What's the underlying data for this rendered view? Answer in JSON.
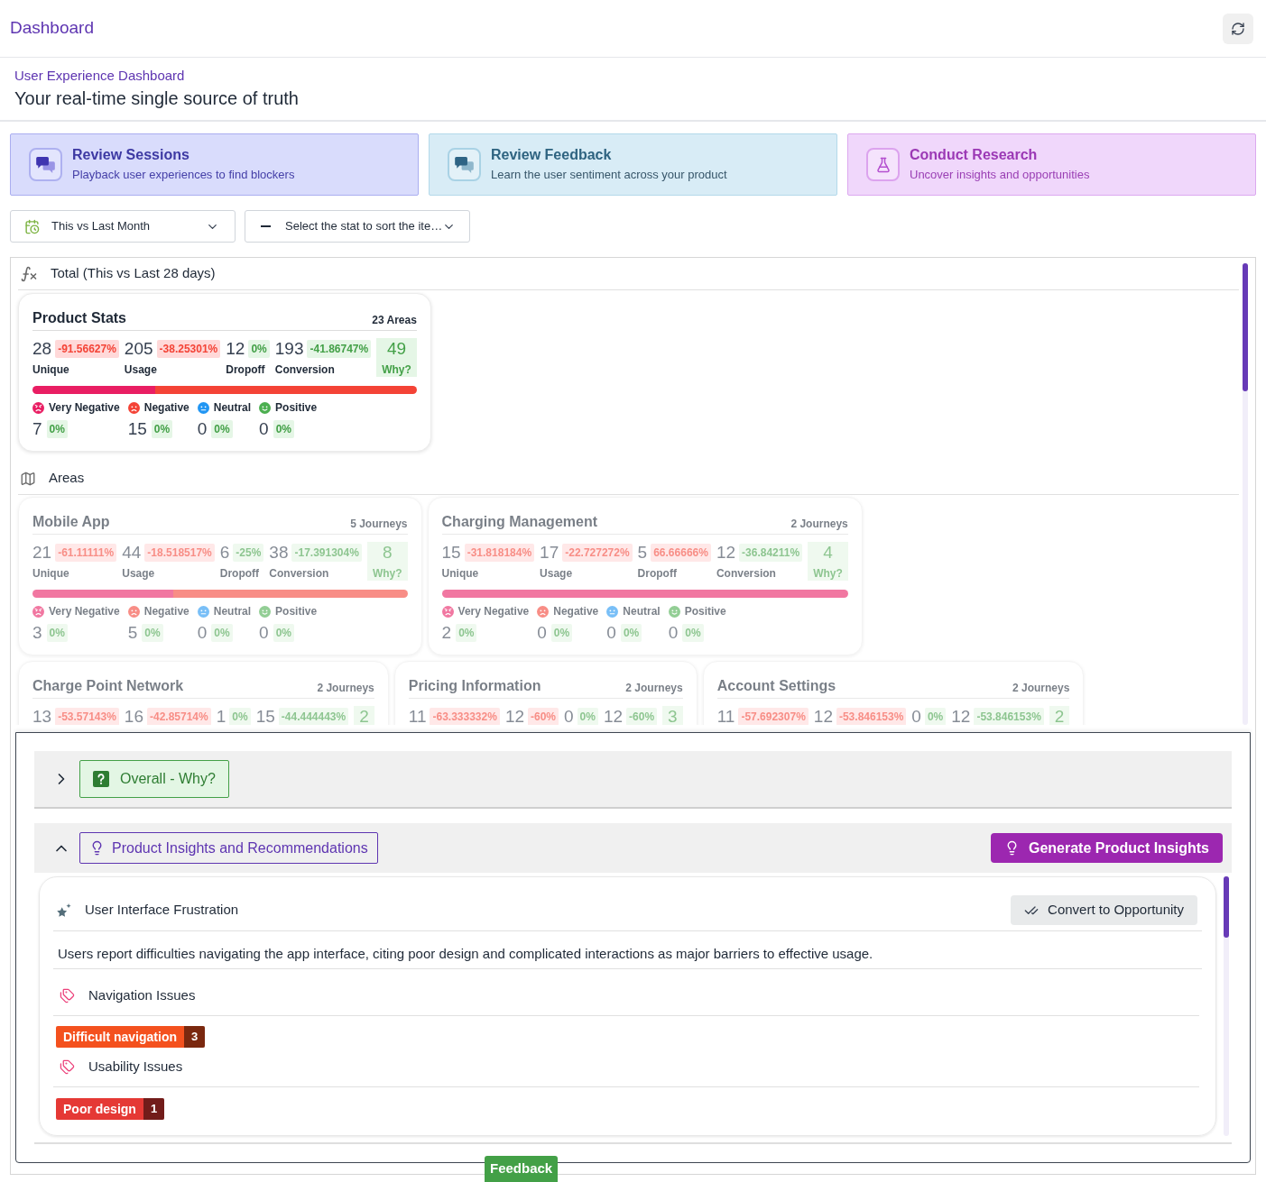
{
  "header": {
    "title": "Dashboard"
  },
  "intro": {
    "kicker": "User Experience Dashboard",
    "heading": "Your real-time single source of truth"
  },
  "action_cards": [
    {
      "kind": "sessions",
      "title": "Review Sessions",
      "subtitle": "Playback user experiences to find blockers"
    },
    {
      "kind": "feedback",
      "title": "Review Feedback",
      "subtitle": "Learn the user sentiment across your product"
    },
    {
      "kind": "research",
      "title": "Conduct Research",
      "subtitle": "Uncover insights and opportunities"
    }
  ],
  "filters": [
    {
      "kind": "period",
      "value": "This vs Last Month"
    },
    {
      "kind": "sort",
      "value": "Select the stat to sort the ite…"
    }
  ],
  "total": {
    "title": "Total (This vs Last 28 days)",
    "card": {
      "name": "Product Stats",
      "count": "23 Areas",
      "stats": [
        {
          "value": "28",
          "change": "-91.56627%",
          "alert": true,
          "label": "Unique"
        },
        {
          "value": "205",
          "change": "-38.25301%",
          "alert": true,
          "label": "Usage"
        },
        {
          "value": "12",
          "change": "0%",
          "alert": false,
          "label": "Dropoff"
        },
        {
          "value": "193",
          "change": "-41.86747%",
          "alert": false,
          "label": "Conversion"
        }
      ],
      "why": {
        "value": "49",
        "label": "Why?"
      },
      "sentiments": [
        {
          "kind": "very_negative",
          "label": "Very Negative",
          "value": "7",
          "change": "0%"
        },
        {
          "kind": "negative",
          "label": "Negative",
          "value": "15",
          "change": "0%"
        },
        {
          "kind": "neutral",
          "label": "Neutral",
          "value": "0",
          "change": "0%"
        },
        {
          "kind": "positive",
          "label": "Positive",
          "value": "0",
          "change": "0%"
        }
      ]
    }
  },
  "areas": {
    "title": "Areas",
    "items": [
      {
        "name": "Mobile App",
        "count": "5 Journeys",
        "stats": [
          {
            "value": "21",
            "change": "-61.11111%",
            "alert": true,
            "label": "Unique"
          },
          {
            "value": "44",
            "change": "-18.518517%",
            "alert": true,
            "label": "Usage"
          },
          {
            "value": "6",
            "change": "-25%",
            "alert": false,
            "label": "Dropoff"
          },
          {
            "value": "38",
            "change": "-17.391304%",
            "alert": false,
            "label": "Conversion"
          }
        ],
        "why": {
          "value": "8",
          "label": "Why?"
        },
        "sentiments": [
          {
            "kind": "very_negative",
            "label": "Very Negative",
            "value": "3",
            "change": "0%"
          },
          {
            "kind": "negative",
            "label": "Negative",
            "value": "5",
            "change": "0%"
          },
          {
            "kind": "neutral",
            "label": "Neutral",
            "value": "0",
            "change": "0%"
          },
          {
            "kind": "positive",
            "label": "Positive",
            "value": "0",
            "change": "0%"
          }
        ]
      },
      {
        "name": "Charging Management",
        "count": "2 Journeys",
        "stats": [
          {
            "value": "15",
            "change": "-31.818184%",
            "alert": true,
            "label": "Unique"
          },
          {
            "value": "17",
            "change": "-22.727272%",
            "alert": true,
            "label": "Usage"
          },
          {
            "value": "5",
            "change": "66.66666%",
            "alert": true,
            "label": "Dropoff"
          },
          {
            "value": "12",
            "change": "-36.84211%",
            "alert": false,
            "label": "Conversion"
          }
        ],
        "why": {
          "value": "4",
          "label": "Why?"
        },
        "sentiments": [
          {
            "kind": "very_negative",
            "label": "Very Negative",
            "value": "2",
            "change": "0%"
          },
          {
            "kind": "negative",
            "label": "Negative",
            "value": "0",
            "change": "0%"
          },
          {
            "kind": "neutral",
            "label": "Neutral",
            "value": "0",
            "change": "0%"
          },
          {
            "kind": "positive",
            "label": "Positive",
            "value": "0",
            "change": "0%"
          }
        ]
      },
      {
        "name": "Charge Point Network",
        "count": "2 Journeys",
        "stats": [
          {
            "value": "13",
            "change": "-53.57143%",
            "alert": true
          },
          {
            "value": "16",
            "change": "-42.85714%",
            "alert": true
          },
          {
            "value": "1",
            "change": "0%",
            "alert": false
          },
          {
            "value": "15",
            "change": "-44.444443%",
            "alert": false
          }
        ],
        "why": {
          "value": "2"
        }
      },
      {
        "name": "Pricing Information",
        "count": "2 Journeys",
        "stats": [
          {
            "value": "11",
            "change": "-63.333332%",
            "alert": true
          },
          {
            "value": "12",
            "change": "-60%",
            "alert": true
          },
          {
            "value": "0",
            "change": "0%",
            "alert": false
          },
          {
            "value": "12",
            "change": "-60%",
            "alert": false
          }
        ],
        "why": {
          "value": "3"
        }
      },
      {
        "name": "Account Settings",
        "count": "2 Journeys",
        "stats": [
          {
            "value": "11",
            "change": "-57.692307%",
            "alert": true
          },
          {
            "value": "12",
            "change": "-53.846153%",
            "alert": true
          },
          {
            "value": "0",
            "change": "0%",
            "alert": false
          },
          {
            "value": "12",
            "change": "-53.846153%",
            "alert": false
          }
        ],
        "why": {
          "value": "2"
        }
      }
    ]
  },
  "drawer": {
    "sections": [
      {
        "kind": "why",
        "label": "Overall - Why?",
        "expanded": false
      },
      {
        "kind": "insights",
        "label": "Product Insights and Recommendations",
        "expanded": true,
        "action": "Generate Product Insights",
        "insight": {
          "title": "User Interface Frustration",
          "action": "Convert to Opportunity",
          "description": "Users report difficulties navigating the app interface, citing poor design and complicated interactions as major barriers to effective usage.",
          "themes": [
            {
              "name": "Navigation Issues",
              "tags": [
                {
                  "label": "Difficult navigation",
                  "count": "3",
                  "color": "#f4511e"
                }
              ]
            },
            {
              "name": "Usability Issues",
              "tags": [
                {
                  "label": "Poor design",
                  "count": "1",
                  "color": "#e53935"
                }
              ]
            }
          ]
        }
      }
    ]
  },
  "feedback_tab": {
    "label": "Feedback"
  }
}
